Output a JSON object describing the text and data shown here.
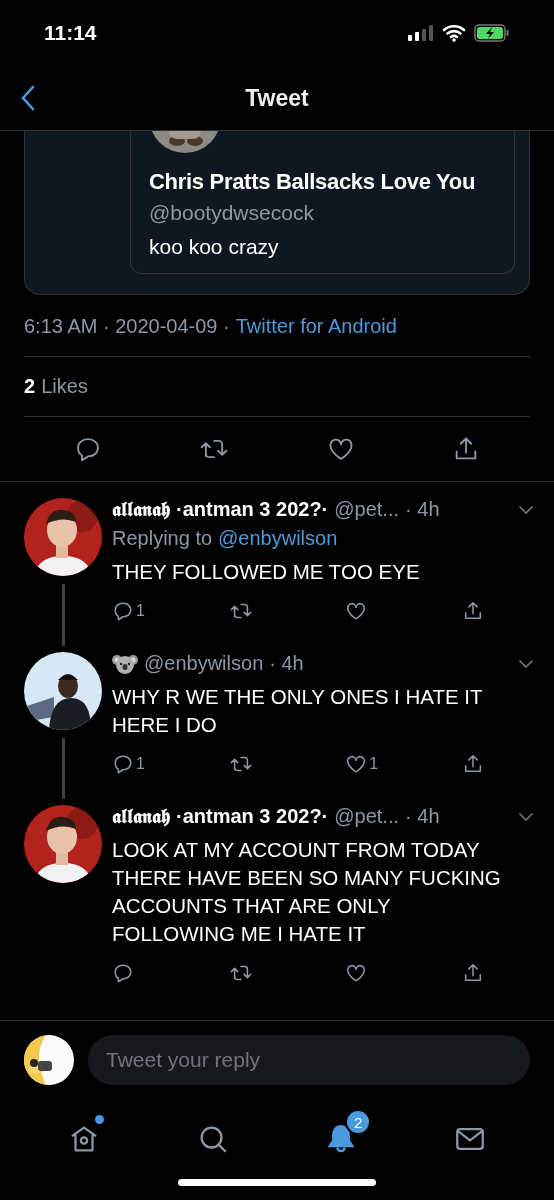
{
  "status_bar": {
    "time": "11:14"
  },
  "nav": {
    "title": "Tweet"
  },
  "quoted_tweet": {
    "name": "Chris Pratts Ballsacks Love You",
    "handle": "@bootydwsecock",
    "text": "koo koo crazy"
  },
  "tweet_meta": {
    "timestamp": "6:13 AM · 2020-04-09 ·",
    "source": "Twitter for Android"
  },
  "likes": {
    "count": "2",
    "label": "Likes"
  },
  "replies": [
    {
      "name": "𝖆𝖑𝖑𝖆𝖓𝖆𝖍",
      "name_suffix": "·antman 3 202?·",
      "handle": "@pet...",
      "time": "· 4h",
      "replying_prefix": "Replying to",
      "replying_to": "@enbywilson",
      "text": "THEY FOLLOWED ME TOO EYE",
      "reply_count": "1",
      "thread_line": true
    },
    {
      "handle": "@enbywilson",
      "time": "· 4h",
      "text": "WHY R WE THE ONLY ONES I HATE IT HERE I DO",
      "reply_count": "1",
      "like_count": "1",
      "thread_line": true
    },
    {
      "name": "𝖆𝖑𝖑𝖆𝖓𝖆𝖍",
      "name_suffix": "·antman 3 202?·",
      "handle": "@pet...",
      "time": "· 4h",
      "text": "LOOK AT MY ACCOUNT FROM TODAY THERE HAVE BEEN SO MANY FUCKING ACCOUNTS THAT ARE ONLY FOLLOWING ME I HATE IT",
      "thread_line": false
    }
  ],
  "reply_field": {
    "placeholder": "Tweet your reply"
  },
  "tabs": [
    {
      "kind": "home",
      "selected": false,
      "dot": true
    },
    {
      "kind": "search",
      "selected": false,
      "dot": false
    },
    {
      "kind": "notifications",
      "selected": true,
      "dot": false,
      "badge": "2"
    },
    {
      "kind": "messages",
      "selected": false,
      "dot": false
    }
  ]
}
